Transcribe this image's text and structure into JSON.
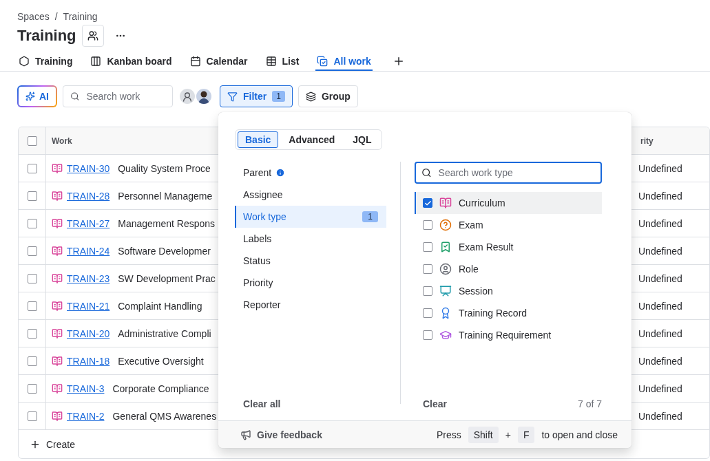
{
  "breadcrumbs": {
    "items": [
      "Spaces",
      "Training"
    ],
    "separator": "/"
  },
  "title": "Training",
  "tabs": [
    {
      "label": "Training",
      "selected": false
    },
    {
      "label": "Kanban board",
      "selected": false
    },
    {
      "label": "Calendar",
      "selected": false
    },
    {
      "label": "List",
      "selected": false
    },
    {
      "label": "All work",
      "selected": true
    }
  ],
  "toolbar": {
    "ai_button": "AI",
    "search": {
      "placeholder": "Search work"
    },
    "filter": {
      "label": "Filter",
      "count": "1",
      "selected": true
    },
    "group": "Group"
  },
  "table": {
    "header_checked": false,
    "columns": [
      {
        "label": "Work"
      },
      {
        "label": "rity"
      }
    ],
    "rows": [
      {
        "key": "TRAIN-30",
        "summary": "Quality System Proce",
        "priority": "Undefined",
        "checked": false
      },
      {
        "key": "TRAIN-28",
        "summary": "Personnel Manageme",
        "priority": "Undefined",
        "checked": false
      },
      {
        "key": "TRAIN-27",
        "summary": "Management Respons",
        "priority": "Undefined",
        "checked": false
      },
      {
        "key": "TRAIN-24",
        "summary": "Software Developmer",
        "priority": "Undefined",
        "checked": false
      },
      {
        "key": "TRAIN-23",
        "summary": "SW Development Prac",
        "priority": "Undefined",
        "checked": false
      },
      {
        "key": "TRAIN-21",
        "summary": "Complaint Handling",
        "priority": "Undefined",
        "checked": false
      },
      {
        "key": "TRAIN-20",
        "summary": "Administrative Compli",
        "priority": "Undefined",
        "checked": false
      },
      {
        "key": "TRAIN-18",
        "summary": "Executive Oversight",
        "priority": "Undefined",
        "checked": false
      },
      {
        "key": "TRAIN-3",
        "summary": "Corporate Compliance",
        "priority": "Undefined",
        "checked": false
      },
      {
        "key": "TRAIN-2",
        "summary": "General QMS Awarenes",
        "priority": "Undefined",
        "checked": false
      }
    ],
    "create": "Create"
  },
  "filter_popover": {
    "modes": [
      {
        "label": "Basic",
        "selected": true
      },
      {
        "label": "Advanced",
        "selected": false
      },
      {
        "label": "JQL",
        "selected": false
      }
    ],
    "fields": [
      {
        "label": "Parent",
        "info": true,
        "selected": false
      },
      {
        "label": "Assignee",
        "info": false,
        "selected": false
      },
      {
        "label": "Work type",
        "info": false,
        "selected": true,
        "count": "1"
      },
      {
        "label": "Labels",
        "info": false,
        "selected": false
      },
      {
        "label": "Status",
        "info": false,
        "selected": false
      },
      {
        "label": "Priority",
        "info": false,
        "selected": false
      },
      {
        "label": "Reporter",
        "info": false,
        "selected": false
      }
    ],
    "clear_all": "Clear all",
    "search": {
      "placeholder": "Search work type"
    },
    "options": [
      {
        "label": "Curriculum",
        "checked": true,
        "selected": true
      },
      {
        "label": "Exam",
        "checked": false,
        "selected": false
      },
      {
        "label": "Exam Result",
        "checked": false,
        "selected": false
      },
      {
        "label": "Role",
        "checked": false,
        "selected": false
      },
      {
        "label": "Session",
        "checked": false,
        "selected": false
      },
      {
        "label": "Training Record",
        "checked": false,
        "selected": false
      },
      {
        "label": "Training Requirement",
        "checked": false,
        "selected": false
      }
    ],
    "clear": "Clear",
    "count": "7 of 7",
    "footer": {
      "feedback": "Give feedback",
      "press": "Press",
      "keys": [
        "Shift",
        "F"
      ],
      "joiner": "+",
      "suffix": "to open and close"
    }
  }
}
